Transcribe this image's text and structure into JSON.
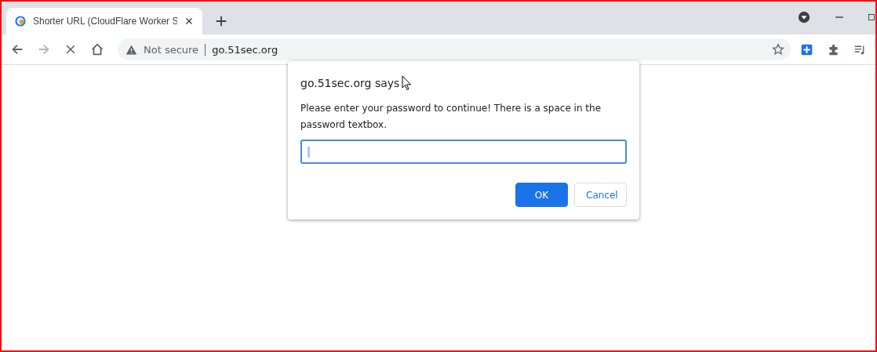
{
  "tab": {
    "title": "Shorter URL (CloudFlare Worker S",
    "selected": true
  },
  "address_bar": {
    "security": "Not secure",
    "url": "go.51sec.org"
  },
  "dialog": {
    "title": "go.51sec.org says",
    "message": "Please enter your password to continue! There is a space in the password textbox.",
    "buttons": [
      {
        "label": "OK",
        "kind": "primary"
      },
      {
        "label": "Cancel",
        "kind": "secondary"
      }
    ]
  }
}
